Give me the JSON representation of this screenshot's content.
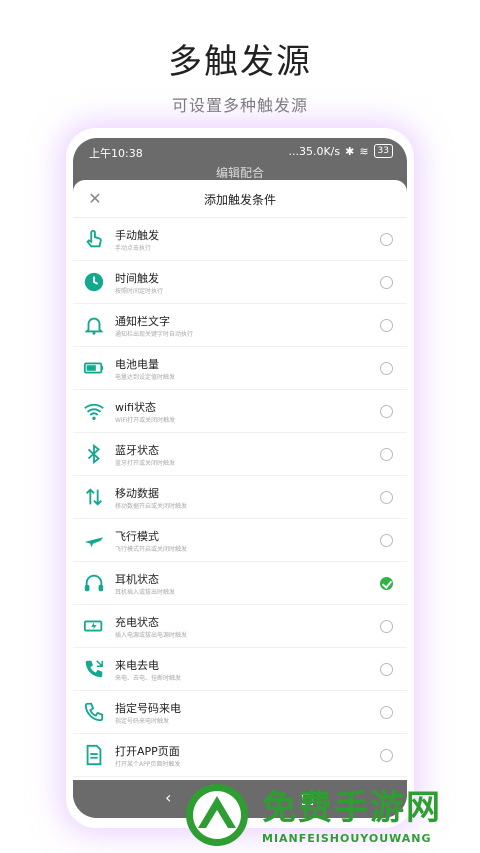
{
  "hero": {
    "title": "多触发源",
    "subtitle": "可设置多种触发源"
  },
  "status_bar": {
    "time": "上午10:38",
    "speed": "...35.0K/s",
    "battery": "33"
  },
  "background_title": "编辑配合",
  "sheet": {
    "title": "添加触发条件"
  },
  "accent_color": "#14a88f",
  "check_color": "#2fb344",
  "items": [
    {
      "title": "手动触发",
      "desc": "手动点击执行",
      "icon": "hand-tap-icon",
      "checked": false
    },
    {
      "title": "时间触发",
      "desc": "按照时间定时执行",
      "icon": "clock-icon",
      "checked": false
    },
    {
      "title": "通知栏文字",
      "desc": "通知栏出现关键字时自动执行",
      "icon": "bell-icon",
      "checked": false
    },
    {
      "title": "电池电量",
      "desc": "电量达到设定值时触发",
      "icon": "battery-icon",
      "checked": false
    },
    {
      "title": "wifi状态",
      "desc": "WiFi打开或关闭时触发",
      "icon": "wifi-icon",
      "checked": false
    },
    {
      "title": "蓝牙状态",
      "desc": "蓝牙打开或关闭时触发",
      "icon": "bluetooth-icon",
      "checked": false
    },
    {
      "title": "移动数据",
      "desc": "移动数据开启或关闭时触发",
      "icon": "data-transfer-icon",
      "checked": false
    },
    {
      "title": "飞行模式",
      "desc": "飞行模式开启或关闭时触发",
      "icon": "airplane-icon",
      "checked": false
    },
    {
      "title": "耳机状态",
      "desc": "耳机插入或拔出时触发",
      "icon": "headphones-icon",
      "checked": true
    },
    {
      "title": "充电状态",
      "desc": "插入电源或拔出电源时触发",
      "icon": "charging-icon",
      "checked": false
    },
    {
      "title": "来电去电",
      "desc": "来电、去电、挂断时触发",
      "icon": "phone-call-icon",
      "checked": false
    },
    {
      "title": "指定号码来电",
      "desc": "指定号码来电时触发",
      "icon": "phone-icon",
      "checked": false
    },
    {
      "title": "打开APP页面",
      "desc": "打开某个APP页面时触发",
      "icon": "document-icon",
      "checked": false
    }
  ],
  "watermark": {
    "text": "免费手游网",
    "sub": "MIANFEISHOUYOUWANG"
  }
}
